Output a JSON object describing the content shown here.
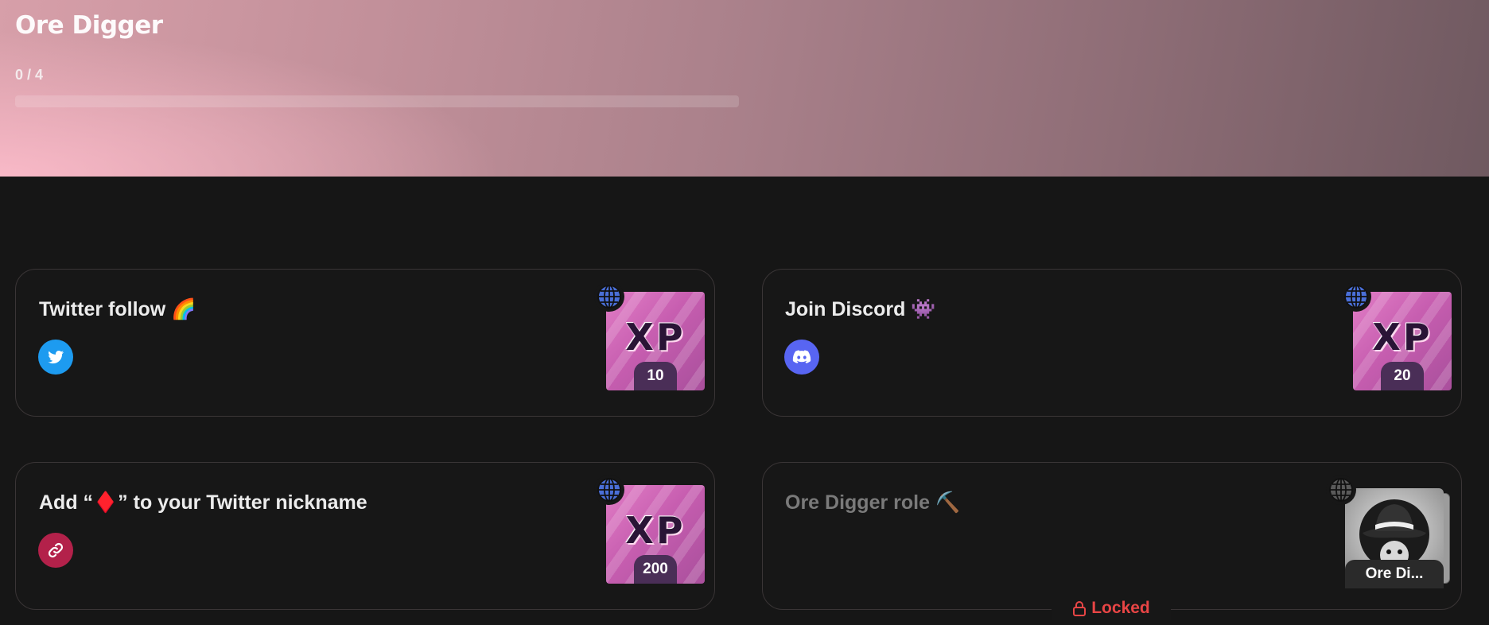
{
  "header": {
    "title": "Ore Digger",
    "progress_text": "0 / 4",
    "progress_fraction": 0
  },
  "tasks": [
    {
      "title": "Twitter follow 🌈",
      "icon": "twitter-icon",
      "icon_color": "#1d9bf0",
      "reward_label": "XP",
      "reward_amount": "10",
      "locked": false
    },
    {
      "title": "Join Discord 👾",
      "icon": "discord-icon",
      "icon_color": "#5865f2",
      "reward_label": "XP",
      "reward_amount": "20",
      "locked": false
    },
    {
      "title": "Add “♦️” to your Twitter nickname",
      "icon": "link-icon",
      "icon_color": "#b3214a",
      "reward_label": "XP",
      "reward_amount": "200",
      "locked": false
    },
    {
      "title": "Ore Digger role ⛏️",
      "icon": "none",
      "reward_label": "Ore Di...",
      "locked": true,
      "locked_text": "Locked"
    }
  ],
  "colors": {
    "background": "#161616",
    "locked": "#e84545",
    "globe": "#4a6fd8",
    "xp_pill": "#4a2e57"
  }
}
